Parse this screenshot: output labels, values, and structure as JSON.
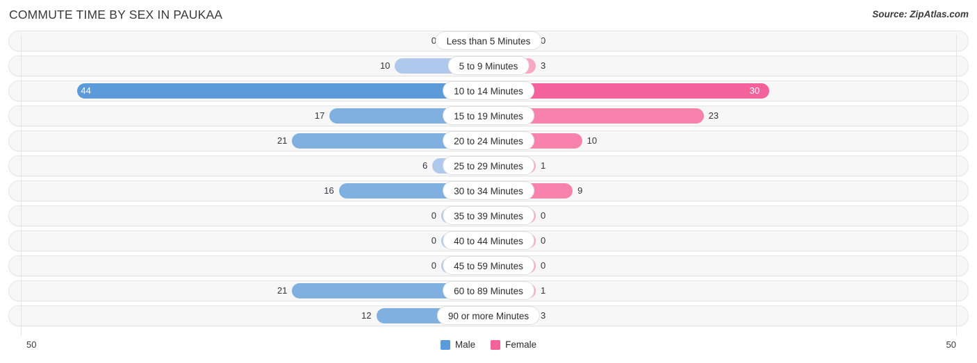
{
  "header": {
    "title": "COMMUTE TIME BY SEX IN PAUKAA",
    "source": "Source: ZipAtlas.com"
  },
  "axis": {
    "left_label": "50",
    "right_label": "50",
    "max": 50
  },
  "legend": {
    "items": [
      {
        "label": "Male",
        "color": "#5b9bd9"
      },
      {
        "label": "Female",
        "color": "#f4629b"
      }
    ]
  },
  "colors": {
    "male_dark": "#5b9bd9",
    "male_mid": "#7fb0e0",
    "male_light": "#aec9ec",
    "female_dark": "#f4629b",
    "female_mid": "#f783ad",
    "female_light": "#f9a8c4",
    "track_bg": "#f7f7f7",
    "track_border": "#e6e6e6",
    "gridline": "#e3e3e3"
  },
  "chart_data": {
    "type": "bar",
    "orientation": "horizontal",
    "style": "diverging-population-pyramid",
    "title": "COMMUTE TIME BY SEX IN PAUKAA",
    "xlabel": "",
    "ylabel": "",
    "xlim": [
      -50,
      50
    ],
    "grid": true,
    "legend_position": "bottom-center",
    "categories": [
      "Less than 5 Minutes",
      "5 to 9 Minutes",
      "10 to 14 Minutes",
      "15 to 19 Minutes",
      "20 to 24 Minutes",
      "25 to 29 Minutes",
      "30 to 34 Minutes",
      "35 to 39 Minutes",
      "40 to 44 Minutes",
      "45 to 59 Minutes",
      "60 to 89 Minutes",
      "90 or more Minutes"
    ],
    "series": [
      {
        "name": "Male",
        "values": [
          0,
          10,
          44,
          17,
          21,
          6,
          16,
          0,
          0,
          0,
          21,
          12
        ]
      },
      {
        "name": "Female",
        "values": [
          0,
          3,
          30,
          23,
          10,
          1,
          9,
          0,
          0,
          0,
          1,
          3
        ]
      }
    ]
  },
  "rows": [
    {
      "category": "Less than 5 Minutes",
      "male": 0,
      "female": 0,
      "male_label": "0",
      "female_label": "0"
    },
    {
      "category": "5 to 9 Minutes",
      "male": 10,
      "female": 3,
      "male_label": "10",
      "female_label": "3"
    },
    {
      "category": "10 to 14 Minutes",
      "male": 44,
      "female": 30,
      "male_label": "44",
      "female_label": "30"
    },
    {
      "category": "15 to 19 Minutes",
      "male": 17,
      "female": 23,
      "male_label": "17",
      "female_label": "23"
    },
    {
      "category": "20 to 24 Minutes",
      "male": 21,
      "female": 10,
      "male_label": "21",
      "female_label": "10"
    },
    {
      "category": "25 to 29 Minutes",
      "male": 6,
      "female": 1,
      "male_label": "6",
      "female_label": "1"
    },
    {
      "category": "30 to 34 Minutes",
      "male": 16,
      "female": 9,
      "male_label": "16",
      "female_label": "9"
    },
    {
      "category": "35 to 39 Minutes",
      "male": 0,
      "female": 0,
      "male_label": "0",
      "female_label": "0"
    },
    {
      "category": "40 to 44 Minutes",
      "male": 0,
      "female": 0,
      "male_label": "0",
      "female_label": "0"
    },
    {
      "category": "45 to 59 Minutes",
      "male": 0,
      "female": 0,
      "male_label": "0",
      "female_label": "0"
    },
    {
      "category": "60 to 89 Minutes",
      "male": 21,
      "female": 1,
      "male_label": "21",
      "female_label": "1"
    },
    {
      "category": "90 or more Minutes",
      "male": 12,
      "female": 3,
      "male_label": "12",
      "female_label": "3"
    }
  ]
}
